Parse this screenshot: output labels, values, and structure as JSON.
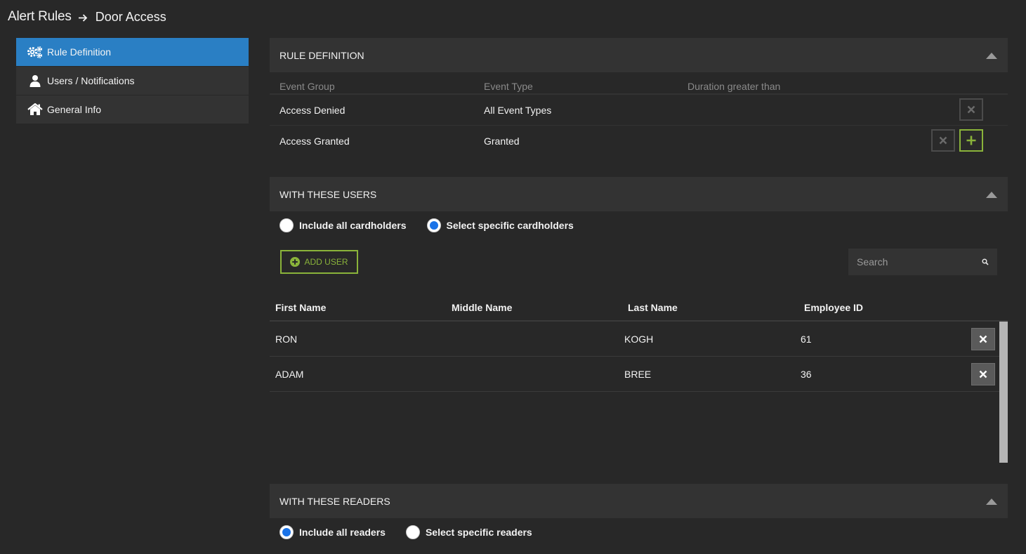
{
  "breadcrumb": {
    "root": "Alert Rules",
    "current": "Door Access"
  },
  "sidebar": {
    "items": [
      {
        "label": "Rule Definition",
        "icon": "gears-icon",
        "active": true
      },
      {
        "label": "Users / Notifications",
        "icon": "user-icon",
        "active": false
      },
      {
        "label": "General Info",
        "icon": "home-icon",
        "active": false
      }
    ]
  },
  "rule_definition": {
    "title": "RULE DEFINITION",
    "columns": [
      "Event Group",
      "Event Type",
      "Duration greater than"
    ],
    "rows": [
      {
        "event_group": "Access Denied",
        "event_type": "All Event Types",
        "duration": ""
      },
      {
        "event_group": "Access Granted",
        "event_type": "Granted",
        "duration": ""
      }
    ]
  },
  "users_section": {
    "title": "WITH THESE USERS",
    "radio_all": "Include all cardholders",
    "radio_specific": "Select specific cardholders",
    "selected": "specific",
    "add_user_label": "ADD USER",
    "search_placeholder": "Search",
    "columns": [
      "First Name",
      "Middle Name",
      "Last Name",
      "Employee ID"
    ],
    "rows": [
      {
        "first": "RON",
        "middle": "",
        "last": "KOGH",
        "employee_id": "61"
      },
      {
        "first": "ADAM",
        "middle": "",
        "last": "BREE",
        "employee_id": "36"
      }
    ]
  },
  "readers_section": {
    "title": "WITH THESE READERS",
    "radio_all": "Include all readers",
    "radio_specific": "Select specific readers",
    "selected": "all"
  },
  "colors": {
    "background": "#282828",
    "panel": "#333333",
    "accent_blue": "#2a7fc4",
    "accent_green": "#8ab33a",
    "radio_blue": "#1a73e8"
  }
}
